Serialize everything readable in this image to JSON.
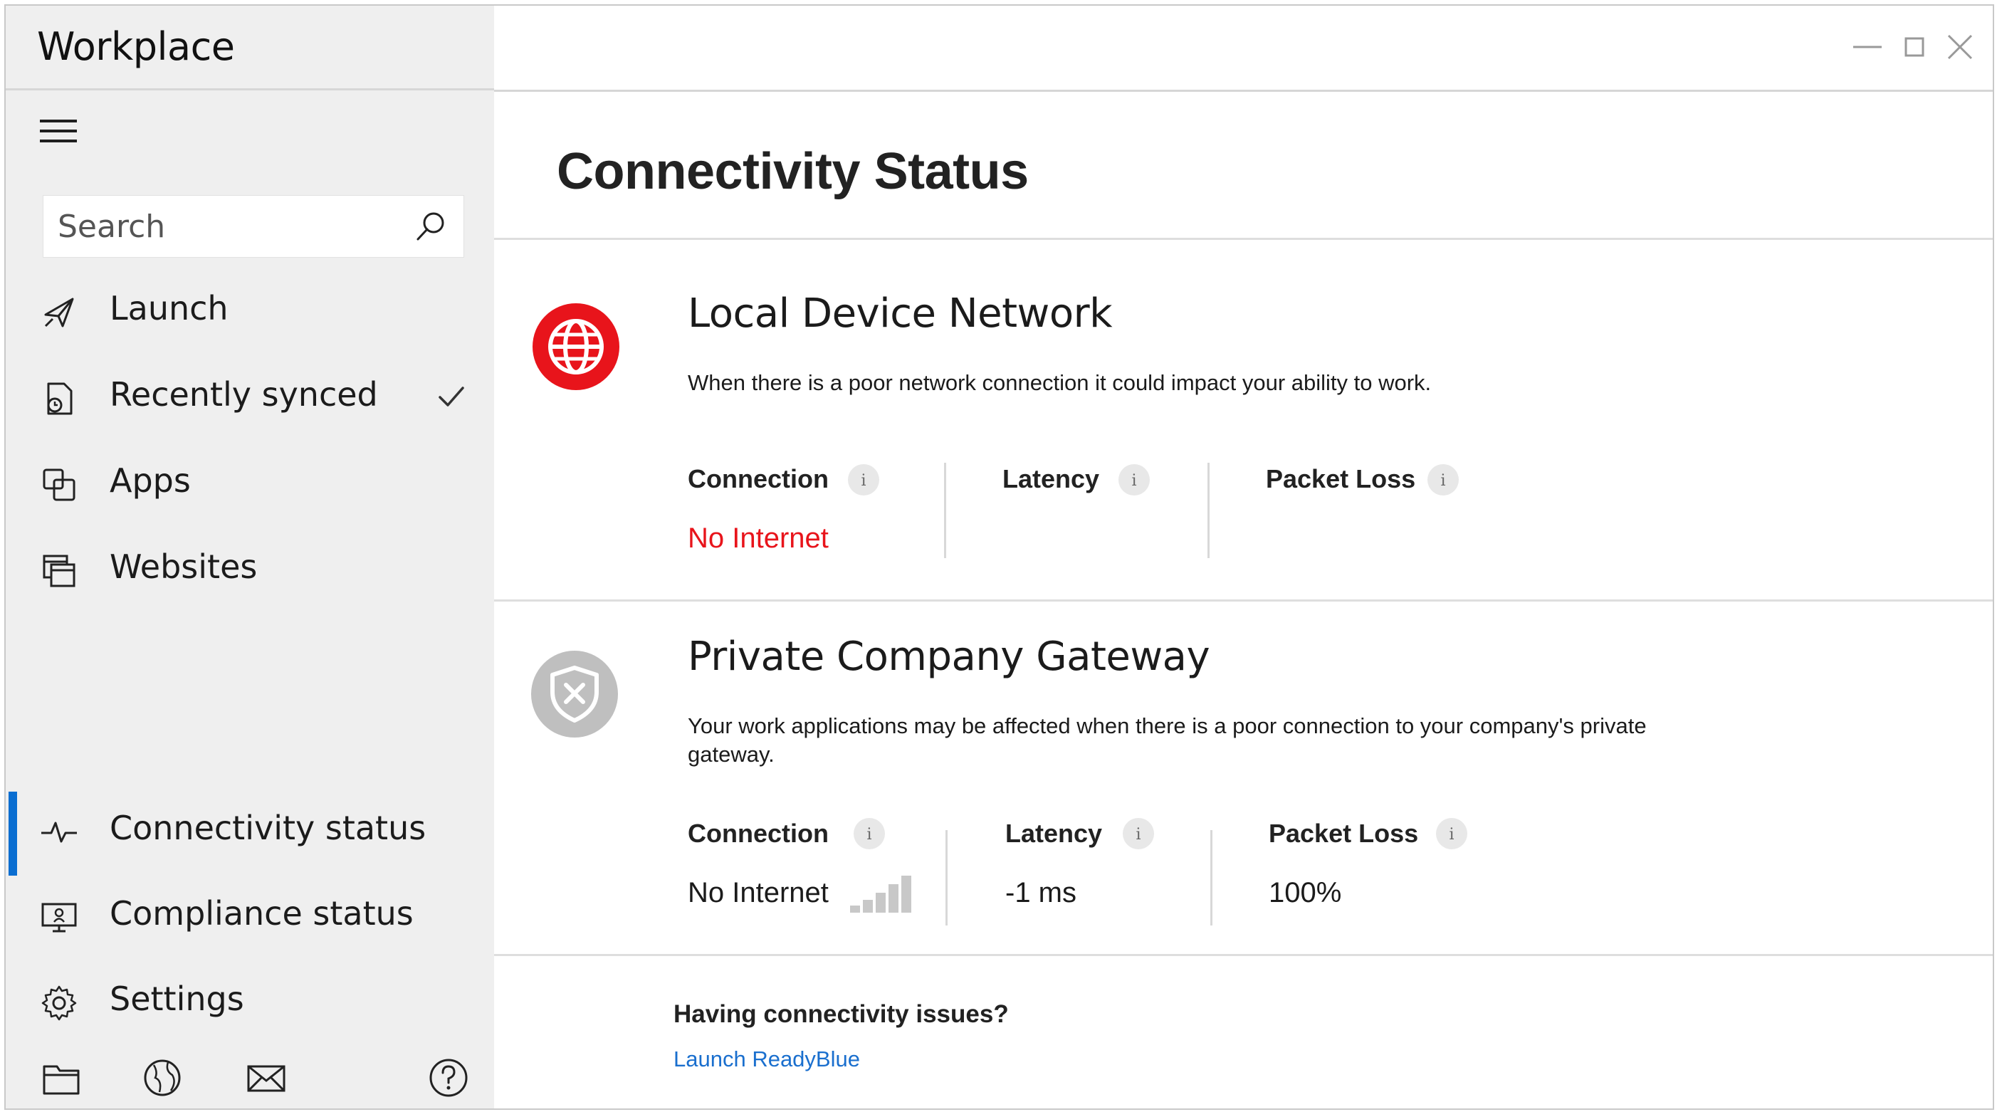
{
  "app": {
    "title": "Workplace"
  },
  "sidebar": {
    "search": {
      "placeholder": "Search",
      "value": ""
    },
    "items": [
      {
        "label": "Launch",
        "icon": "rocket-icon"
      },
      {
        "label": "Recently synced",
        "icon": "synced-document-icon",
        "checked": true
      },
      {
        "label": "Apps",
        "icon": "apps-icon"
      },
      {
        "label": "Websites",
        "icon": "websites-icon"
      },
      {
        "label": "Connectivity status",
        "icon": "pulse-icon",
        "active": true
      },
      {
        "label": "Compliance status",
        "icon": "compliance-monitor-icon"
      },
      {
        "label": "Settings",
        "icon": "gear-icon"
      }
    ],
    "bottom_icons": [
      "folder-icon",
      "globe-icon",
      "mail-icon",
      "help-icon"
    ]
  },
  "main": {
    "title": "Connectivity Status",
    "sections": [
      {
        "title": "Local Device Network",
        "description": "When there is a poor network connection it could impact your ability to work.",
        "icon": "globe-error-icon",
        "icon_color": "#e8141b",
        "metrics": [
          {
            "label": "Connection",
            "value": "No Internet",
            "value_color": "#e8141b"
          },
          {
            "label": "Latency",
            "value": ""
          },
          {
            "label": "Packet Loss",
            "value": ""
          }
        ]
      },
      {
        "title": "Private Company Gateway",
        "description": "Your work applications may be affected when there is a poor connection to your company's private gateway.",
        "icon": "shield-x-icon",
        "icon_color": "#bfbfbf",
        "metrics": [
          {
            "label": "Connection",
            "value": "No Internet",
            "value_color": "#1b1b1b",
            "signal_icon": "signal-strength-icon"
          },
          {
            "label": "Latency",
            "value": "-1 ms"
          },
          {
            "label": "Packet Loss",
            "value": "100%"
          }
        ]
      }
    ],
    "help": {
      "heading": "Having connectivity issues?",
      "link_label": "Launch ReadyBlue"
    }
  },
  "colors": {
    "accent": "#0a6ed1",
    "error": "#e8141b",
    "link": "#1a6fce",
    "sidebar_bg": "#efefef"
  }
}
